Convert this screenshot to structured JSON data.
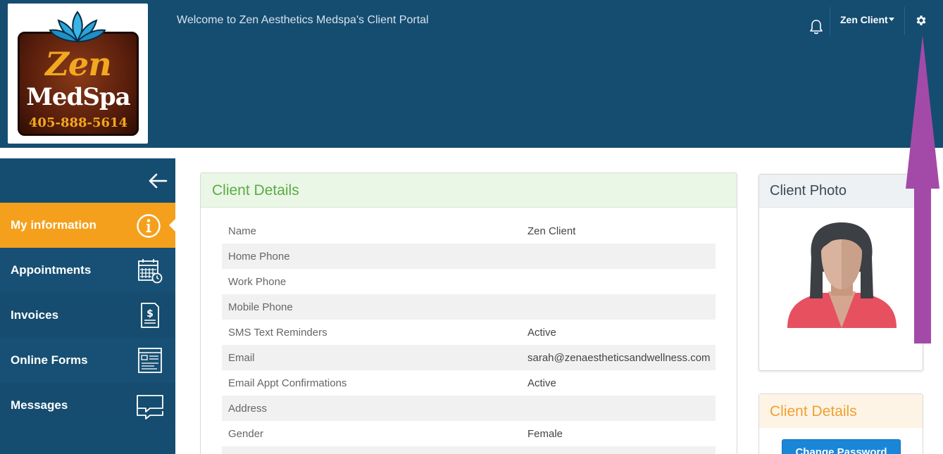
{
  "header": {
    "welcome": "Welcome to Zen Aesthetics Medspa's Client Portal",
    "user_name": "Zen Client",
    "logo": {
      "brand": "Zen",
      "sub": "MedSpa",
      "phone": "405-888-5614"
    }
  },
  "sidebar": {
    "items": [
      {
        "label": "My information",
        "icon": "info-icon",
        "active": true
      },
      {
        "label": "Appointments",
        "icon": "calendar-icon",
        "active": false
      },
      {
        "label": "Invoices",
        "icon": "invoice-icon",
        "active": false
      },
      {
        "label": "Online Forms",
        "icon": "form-icon",
        "active": false
      },
      {
        "label": "Messages",
        "icon": "messages-icon",
        "active": false
      }
    ]
  },
  "client_details": {
    "title": "Client Details",
    "rows": [
      {
        "key": "Name",
        "value": "Zen Client"
      },
      {
        "key": "Home Phone",
        "value": ""
      },
      {
        "key": "Work Phone",
        "value": ""
      },
      {
        "key": "Mobile Phone",
        "value": ""
      },
      {
        "key": "SMS Text Reminders",
        "value": "Active"
      },
      {
        "key": "Email",
        "value": "sarah@zenaestheticsandwellness.com"
      },
      {
        "key": "Email Appt Confirmations",
        "value": "Active"
      },
      {
        "key": "Address",
        "value": ""
      },
      {
        "key": "Gender",
        "value": "Female"
      },
      {
        "key": "",
        "value": ""
      }
    ]
  },
  "photo_panel": {
    "title": "Client Photo"
  },
  "side_details": {
    "title": "Client Details",
    "button": "Change Password"
  },
  "colors": {
    "header_bg": "#154d71",
    "active_nav": "#f5a01c",
    "details_title": "#5aac44",
    "side_details_title": "#f0a030",
    "button": "#1a86d8",
    "annotation_arrow": "#a34aa8"
  }
}
